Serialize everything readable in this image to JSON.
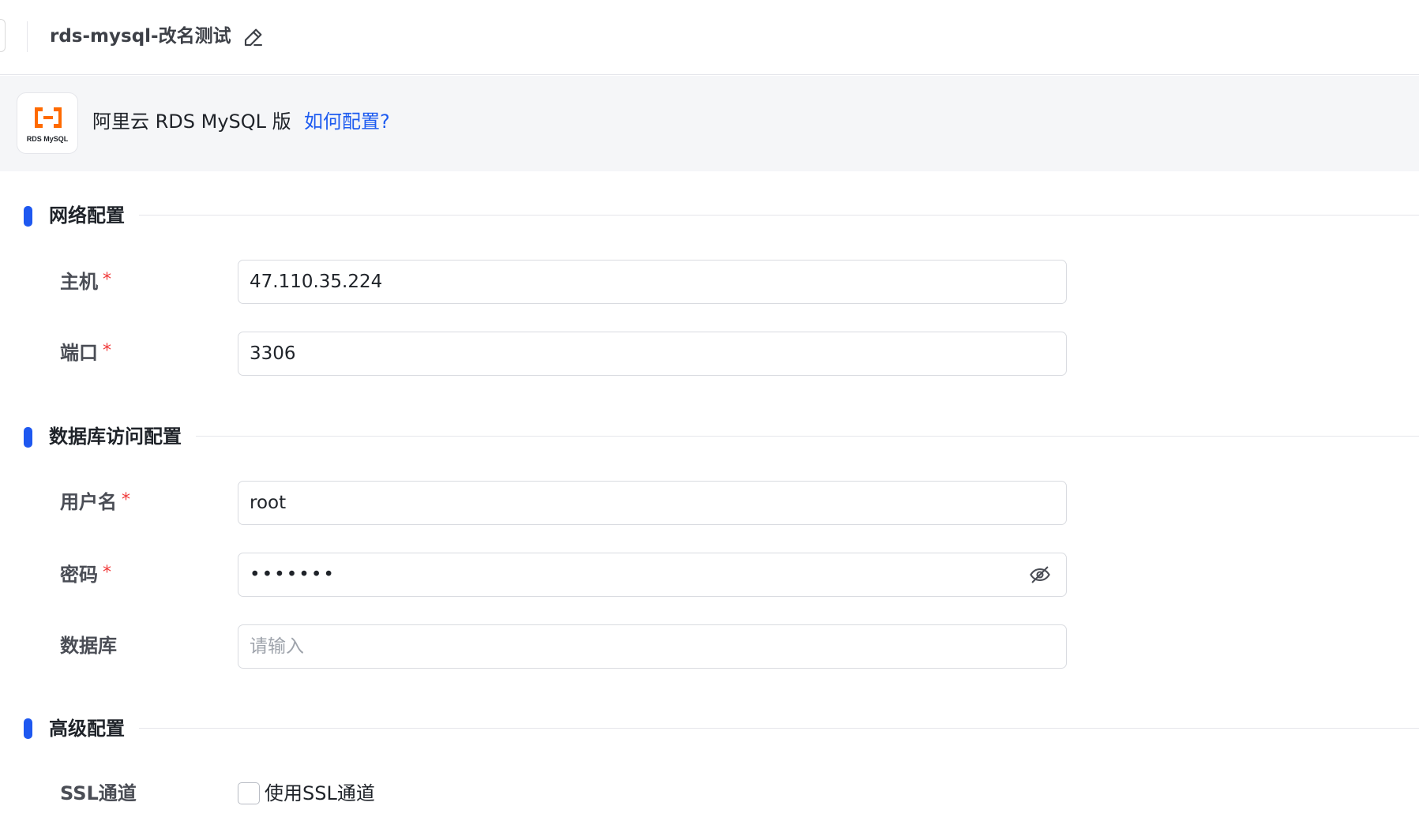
{
  "header": {
    "title": "rds-mysql-改名测试"
  },
  "datasource": {
    "logo_text": "RDS MySQL",
    "name": "阿里云 RDS MySQL 版",
    "help_link": "如何配置?",
    "logo_color": "#ff6a00"
  },
  "sections": {
    "network": {
      "title": "网络配置",
      "host": {
        "label": "主机",
        "value": "47.110.35.224",
        "required": "*"
      },
      "port": {
        "label": "端口",
        "value": "3306",
        "required": "*"
      }
    },
    "database_access": {
      "title": "数据库访问配置",
      "username": {
        "label": "用户名",
        "value": "root",
        "required": "*"
      },
      "password": {
        "label": "密码",
        "value": "•••••••",
        "required": "*"
      },
      "database": {
        "label": "数据库",
        "value": "",
        "placeholder": "请输入"
      }
    },
    "advanced": {
      "title": "高级配置",
      "ssl": {
        "label": "SSL通道",
        "checkbox_label": "使用SSL通道",
        "checked": false
      }
    }
  },
  "colors": {
    "accent": "#1e58f0",
    "link": "#1d5bf0",
    "required": "#f03a3a"
  }
}
